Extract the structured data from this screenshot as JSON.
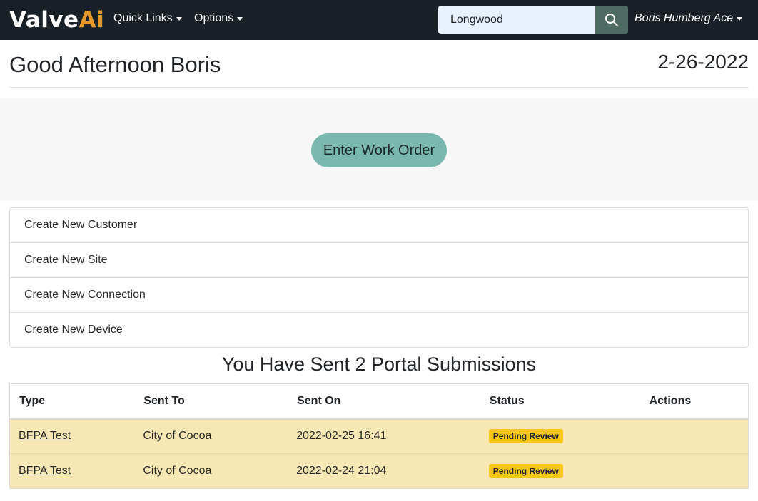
{
  "nav": {
    "brand_part1": "Valve",
    "brand_part2": "Ai",
    "quick_links": "Quick Links",
    "options": "Options",
    "search_value": "Longwood",
    "user": "Boris Humberg Ace"
  },
  "header": {
    "greeting": "Good Afternoon Boris",
    "date": "2-26-2022"
  },
  "jumbotron": {
    "button_label": "Enter Work Order"
  },
  "quick_actions": [
    {
      "label": "Create New Customer"
    },
    {
      "label": "Create New Site"
    },
    {
      "label": "Create New Connection"
    },
    {
      "label": "Create New Device"
    }
  ],
  "submissions": {
    "title": "You Have Sent 2 Portal Submissions",
    "columns": [
      "Type",
      "Sent To",
      "Sent On",
      "Status",
      "Actions"
    ],
    "rows": [
      {
        "type": "BFPA Test",
        "sent_to": "City of Cocoa",
        "sent_on": "2022-02-25 16:41",
        "status": "Pending Review",
        "actions": ""
      },
      {
        "type": "BFPA Test",
        "sent_to": "City of Cocoa",
        "sent_on": "2022-02-24 21:04",
        "status": "Pending Review",
        "actions": ""
      }
    ]
  },
  "colors": {
    "navbar": "#1a2028",
    "brand_accent": "#e69a2b",
    "work_order_button": "#7ab7ad",
    "row_warning": "#f6e7b5",
    "badge_warning": "#f5c518"
  },
  "icons": {
    "search": "search-icon"
  }
}
